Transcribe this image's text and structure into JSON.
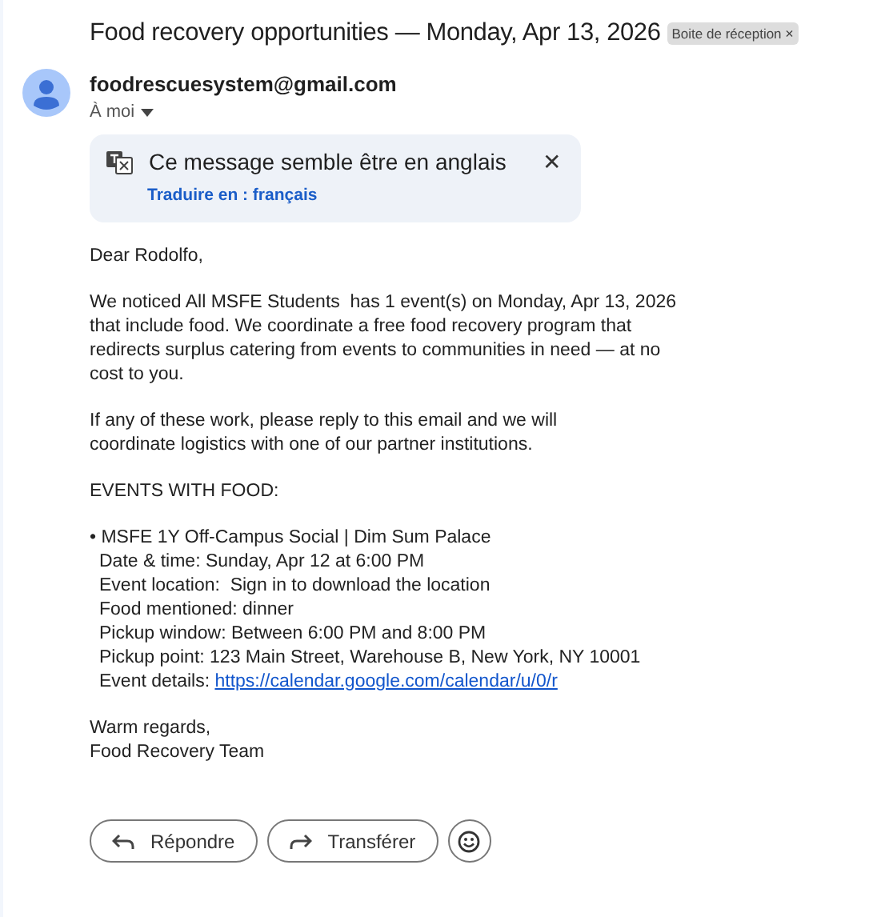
{
  "subject": "Food recovery opportunities — Monday, Apr 13, 2026",
  "label": {
    "text": "Boite de réception",
    "close": "×"
  },
  "sender": {
    "email": "foodrescuesystem@gmail.com",
    "to": "À moi"
  },
  "translate_banner": {
    "message": "Ce message semble être en anglais",
    "link": "Traduire en : français",
    "close": "✕"
  },
  "greeting": "Dear Rodolfo,",
  "paragraphs": [
    [
      "We noticed All MSFE Students  has 1 event(s) on Monday, Apr 13, 2026",
      "that include food. We coordinate a free food recovery program that",
      "redirects surplus catering from events to communities in need — at no",
      "cost to you."
    ],
    [
      "If any of these work, please reply to this email and we will",
      "coordinate logistics with one of our partner institutions."
    ]
  ],
  "events_heading": "EVENTS WITH FOOD:",
  "event": {
    "title": "• MSFE 1Y Off-Campus Social | Dim Sum Palace",
    "lines": [
      "Date & time: Sunday, Apr 12 at 6:00 PM",
      "Event location:  Sign in to download the location",
      "Food mentioned: dinner",
      "Pickup window: Between 6:00 PM and 8:00 PM",
      "Pickup point: 123 Main Street, Warehouse B, New York, NY 10001"
    ],
    "details_label": "Event details: ",
    "details_link": "https://calendar.google.com/calendar/u/0/r"
  },
  "signoff": [
    "Warm regards,",
    "Food Recovery Team"
  ],
  "actions": [
    {
      "kind": "reply",
      "label": "Répondre"
    },
    {
      "kind": "forward",
      "label": "Transférer"
    },
    {
      "kind": "emoji"
    }
  ]
}
